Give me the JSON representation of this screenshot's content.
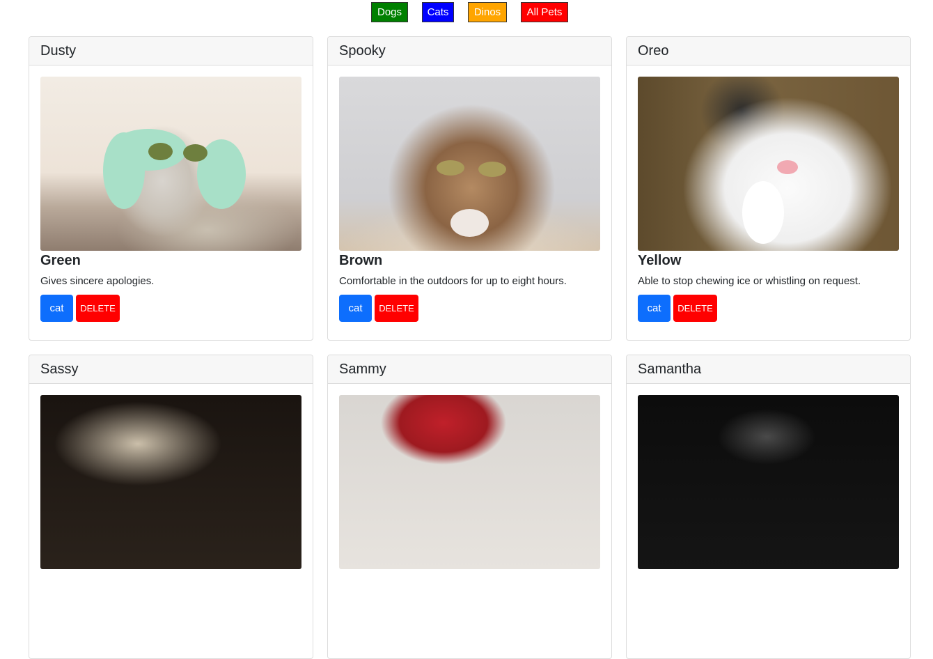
{
  "filters": {
    "dogs_label": "Dogs",
    "cats_label": "Cats",
    "dinos_label": "Dinos",
    "all_label": "All Pets",
    "colors": {
      "dogs": "#008000",
      "cats": "#0000ff",
      "dinos": "#ffa500",
      "all": "#ff0000"
    }
  },
  "pets": [
    {
      "name": "Dusty",
      "color": "Green",
      "description": "Gives sincere apologies.",
      "type": "cat",
      "delete_label": "DELETE"
    },
    {
      "name": "Spooky",
      "color": "Brown",
      "description": "Comfortable in the outdoors for up to eight hours.",
      "type": "cat",
      "delete_label": "DELETE"
    },
    {
      "name": "Oreo",
      "color": "Yellow",
      "description": "Able to stop chewing ice or whistling on request.",
      "type": "cat",
      "delete_label": "DELETE"
    },
    {
      "name": "Sassy"
    },
    {
      "name": "Sammy"
    },
    {
      "name": "Samantha"
    }
  ],
  "theme": {
    "type_button": "#0d6efd",
    "delete_button": "#ff0000"
  }
}
